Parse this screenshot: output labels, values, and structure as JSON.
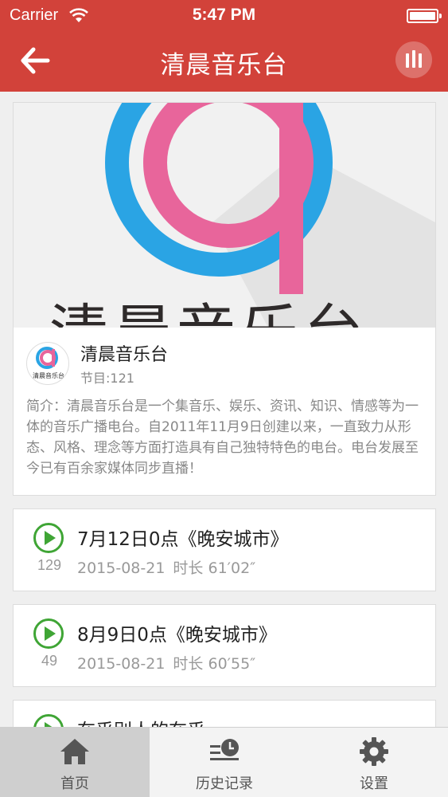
{
  "status_bar": {
    "carrier": "Carrier",
    "time": "5:47 PM"
  },
  "nav": {
    "title": "清晨音乐台"
  },
  "station": {
    "banner_text": "清晨音乐台",
    "logo_text": "清晨音乐台",
    "name": "清晨音乐台",
    "program_count": "节目:121",
    "description": "简介：清晨音乐台是一个集音乐、娱乐、资讯、知识、情感等为一体的音乐广播电台。自2011年11月9日创建以来，一直致力从形态、风格、理念等方面打造具有自己独特特色的电台。电台发展至今已有百余家媒体同步直播！"
  },
  "episodes": [
    {
      "title": "7月12日0点《晚安城市》",
      "plays": "129",
      "date": "2015-08-21",
      "duration_label": "时长",
      "duration": "61′02″"
    },
    {
      "title": "8月9日0点《晚安城市》",
      "plays": "49",
      "date": "2015-08-21",
      "duration_label": "时长",
      "duration": "60′55″"
    },
    {
      "title": "在乎别人的在乎"
    }
  ],
  "tabbar": {
    "home": "首页",
    "history": "历史记录",
    "settings": "设置"
  },
  "colors": {
    "brand_red": "#d2423a",
    "play_green": "#3fa535",
    "logo_blue": "#2aa4e4",
    "logo_pink": "#e8659b"
  },
  "icons": {
    "back": "arrow-left-icon",
    "player": "equalizer-bars-icon",
    "play": "play-circle-icon",
    "home": "home-icon",
    "history": "history-icon",
    "settings": "gear-icon"
  }
}
